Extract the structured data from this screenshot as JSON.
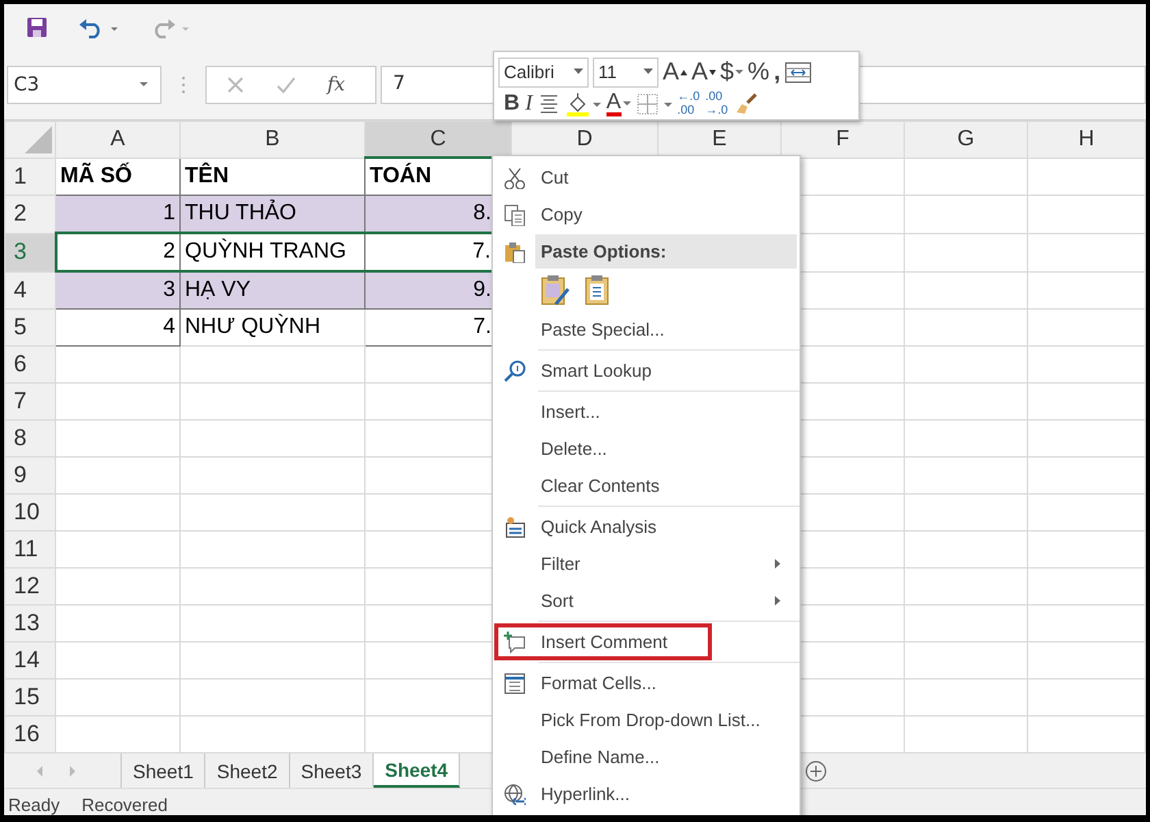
{
  "formula_bar": {
    "name_box": "C3",
    "function_label": "fx",
    "formula": "7"
  },
  "mini_toolbar": {
    "font": "Calibri",
    "size": "11",
    "row1": [
      {
        "kind": "grow",
        "label": "A"
      },
      {
        "kind": "shrink",
        "label": "A"
      },
      {
        "kind": "currency",
        "label": "$"
      },
      {
        "kind": "percent",
        "label": "%"
      },
      {
        "kind": "comma",
        "label": ","
      },
      {
        "kind": "wrap"
      }
    ],
    "row2": [
      {
        "kind": "bold",
        "label": "B"
      },
      {
        "kind": "italic",
        "label": "I"
      },
      {
        "kind": "center"
      },
      {
        "kind": "fill"
      },
      {
        "kind": "fontcolor",
        "label": "A"
      },
      {
        "kind": "borders"
      },
      {
        "kind": "decimal-up",
        "top": "←.0",
        "bottom": ".00"
      },
      {
        "kind": "decimal-down",
        "top": ".00",
        "bottom": "→.0"
      },
      {
        "kind": "painter"
      }
    ]
  },
  "columns": [
    {
      "label": "A",
      "selected": false
    },
    {
      "label": "B",
      "selected": false
    },
    {
      "label": "C",
      "selected": true
    },
    {
      "label": "D",
      "selected": false
    },
    {
      "label": "E",
      "selected": false
    },
    {
      "label": "F",
      "selected": false
    },
    {
      "label": "G",
      "selected": false
    },
    {
      "label": "H",
      "selected": false
    }
  ],
  "row_headers": [
    {
      "label": "1",
      "selected": false
    },
    {
      "label": "2",
      "selected": false
    },
    {
      "label": "3",
      "selected": true
    },
    {
      "label": "4",
      "selected": false
    },
    {
      "label": "5",
      "selected": false
    },
    {
      "label": "6",
      "selected": false
    },
    {
      "label": "7",
      "selected": false
    },
    {
      "label": "8",
      "selected": false
    },
    {
      "label": "9",
      "selected": false
    },
    {
      "label": "10",
      "selected": false
    },
    {
      "label": "11",
      "selected": false
    },
    {
      "label": "12",
      "selected": false
    },
    {
      "label": "13",
      "selected": false
    },
    {
      "label": "14",
      "selected": false
    },
    {
      "label": "15",
      "selected": false
    },
    {
      "label": "16",
      "selected": false
    }
  ],
  "rows": [
    {
      "kind": "header",
      "shaded": false,
      "selected": false,
      "cells": [
        "MÃ SỐ",
        "TÊN",
        "TOÁN"
      ]
    },
    {
      "kind": "data",
      "shaded": true,
      "selected": false,
      "cells": [
        "1",
        "THU THẢO",
        "8."
      ]
    },
    {
      "kind": "data",
      "shaded": false,
      "selected": true,
      "cells": [
        "2",
        "QUỲNH TRANG",
        "7."
      ]
    },
    {
      "kind": "data",
      "shaded": true,
      "selected": false,
      "cells": [
        "3",
        "HẠ VY",
        "9."
      ]
    },
    {
      "kind": "data",
      "shaded": false,
      "selected": false,
      "cells": [
        "4",
        "NHƯ QUỲNH",
        "7."
      ]
    }
  ],
  "sheet_tabs": [
    {
      "label": "Sheet1",
      "selected": false
    },
    {
      "label": "Sheet2",
      "selected": false
    },
    {
      "label": "Sheet3",
      "selected": false
    },
    {
      "label": "Sheet4",
      "selected": true
    }
  ],
  "status_bar": [
    "Ready",
    "Recovered"
  ],
  "context_menu": [
    {
      "items": [
        {
          "kind": "command",
          "label": "Cut",
          "highlighted": false
        },
        {
          "kind": "command",
          "label": "Copy",
          "highlighted": false
        },
        {
          "kind": "heading",
          "label": "Paste Options:",
          "highlighted": false
        },
        {
          "kind": "paste-buttons",
          "highlighted": false
        },
        {
          "kind": "command",
          "label": "Paste Special...",
          "highlighted": false
        }
      ]
    },
    {
      "items": [
        {
          "kind": "command",
          "label": "Smart Lookup",
          "highlighted": false
        }
      ]
    },
    {
      "items": [
        {
          "kind": "command",
          "label": "Insert...",
          "highlighted": false
        },
        {
          "kind": "command",
          "label": "Delete...",
          "highlighted": false
        },
        {
          "kind": "command",
          "label": "Clear Contents",
          "highlighted": false
        }
      ]
    },
    {
      "items": [
        {
          "kind": "command",
          "label": "Quick Analysis",
          "highlighted": false
        },
        {
          "kind": "submenu",
          "label": "Filter",
          "highlighted": false
        },
        {
          "kind": "submenu",
          "label": "Sort",
          "highlighted": false
        }
      ]
    },
    {
      "items": [
        {
          "kind": "command",
          "label": "Insert Comment",
          "highlighted": true
        }
      ]
    },
    {
      "items": [
        {
          "kind": "command",
          "label": "Format Cells...",
          "highlighted": false
        },
        {
          "kind": "command",
          "label": "Pick From Drop-down List...",
          "highlighted": false
        },
        {
          "kind": "command",
          "label": "Define Name...",
          "highlighted": false
        },
        {
          "kind": "command",
          "label": "Hyperlink...",
          "highlighted": false
        }
      ]
    }
  ]
}
